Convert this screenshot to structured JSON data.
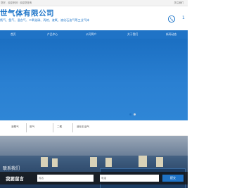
{
  "topbar": {
    "welcome": "您好，欢迎来到！欢迎您咨询",
    "links": "关注我们"
  },
  "header": {
    "company": "世气体有限公司",
    "products": "氮气、氩气、混合气、二氧化碳、丙烷、液氧、液化石油气等工业气体",
    "phone_icon": "phone-icon",
    "phone": "1"
  },
  "nav": [
    "首页",
    "产品中心",
    "公司简介",
    "关于我们",
    "新闻动态"
  ],
  "banner": {
    "accent": "#1f73c6",
    "dots": [
      {
        "active": true
      },
      {
        "active": false
      }
    ]
  },
  "filters": [
    "液氧气",
    "氮气",
    "二氧",
    "液化石油气"
  ],
  "photo": {
    "caption": "联系我们"
  },
  "message": {
    "label": "我要留言",
    "name_placeholder": "姓名",
    "phone_placeholder": "电话",
    "submit": "提交"
  }
}
